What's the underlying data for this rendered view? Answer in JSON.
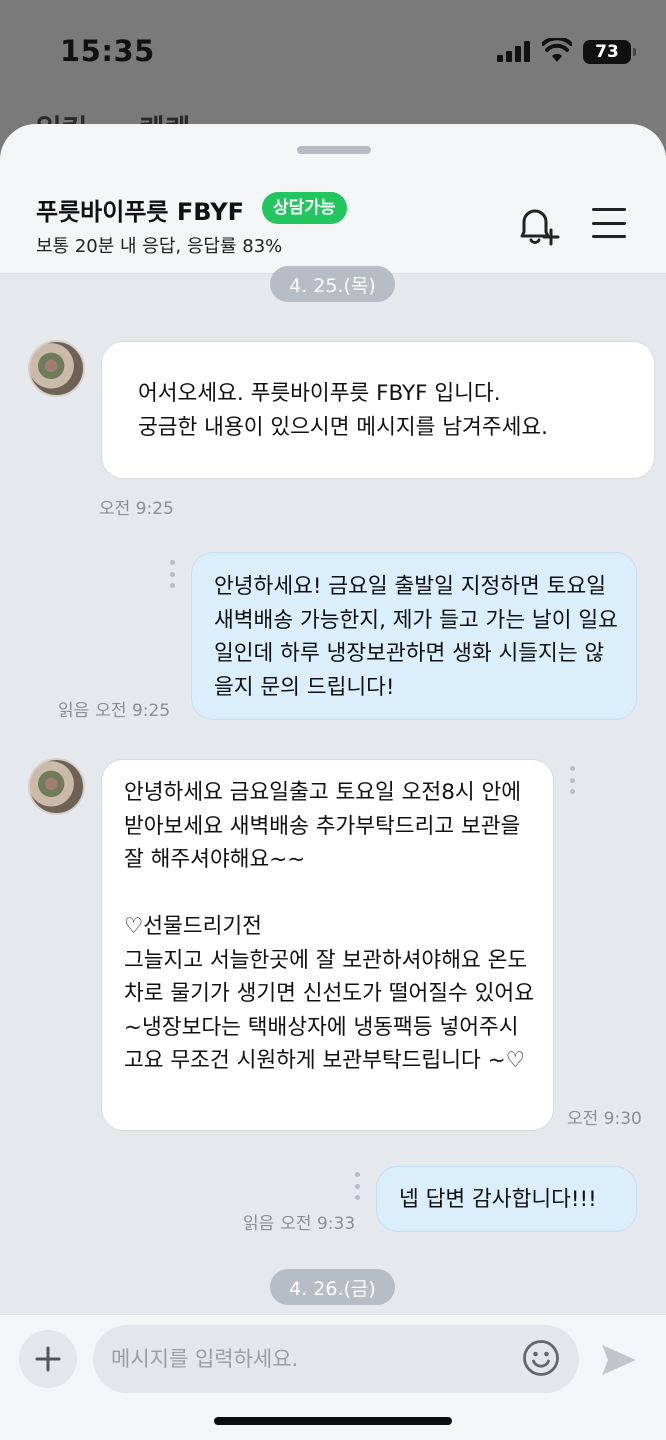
{
  "status_bar": {
    "time": "15:35",
    "battery": "73"
  },
  "behind_sheet": {
    "title": "일킨 ... 퀘퀘"
  },
  "header": {
    "shop_name": "푸릇바이푸릇 FBYF",
    "badge": "상담가능",
    "response_info": "보통 20분 내 응답, 응답률 83%",
    "icons": [
      "bell-plus-icon",
      "hamburger-menu-icon"
    ]
  },
  "chat": {
    "dates": [
      "4. 25.(목)",
      "4. 26.(금)"
    ],
    "messages": [
      {
        "from": "shop",
        "text": "어서오세요. 푸릇바이푸릇 FBYF 입니다.\n궁금한 내용이 있으시면 메시지를 남겨주세요.",
        "time": "오전 9:25"
      },
      {
        "from": "me",
        "text": "안녕하세요! 금요일 출발일 지정하면 토요일 새벽배송 가능한지, 제가 들고 가는 날이 일요일인데 하루 냉장보관하면 생화 시들지는 않을지 문의 드립니다!",
        "read": "읽음",
        "time": "오전 9:25"
      },
      {
        "from": "shop",
        "text": "안녕하세요 금요일출고 토요일 오전8시 안에 받아보세요 새벽배송 추가부탁드리고 보관을 잘 해주셔야해요~~\n\n♡선물드리기전\n그늘지고 서늘한곳에 잘 보관하셔야해요 온도차로 물기가 생기면 신선도가 떨어질수 있어요~냉장보다는 택배상자에 냉동팩등 넣어주시고요 무조건 시원하게 보관부탁드립니다 ~♡",
        "time": "오전 9:30"
      },
      {
        "from": "me",
        "text": "넵 답변 감사합니다!!!",
        "read": "읽음",
        "time": "오전 9:33"
      }
    ]
  },
  "composer": {
    "placeholder": "메시지를 입력하세요."
  }
}
